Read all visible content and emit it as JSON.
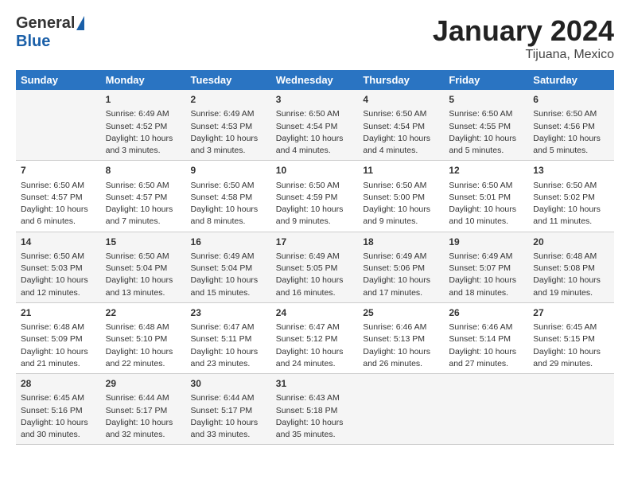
{
  "logo": {
    "general": "General",
    "blue": "Blue",
    "tagline": ""
  },
  "title": "January 2024",
  "subtitle": "Tijuana, Mexico",
  "headers": [
    "Sunday",
    "Monday",
    "Tuesday",
    "Wednesday",
    "Thursday",
    "Friday",
    "Saturday"
  ],
  "weeks": [
    [
      {
        "day": "",
        "sunrise": "",
        "sunset": "",
        "daylight": ""
      },
      {
        "day": "1",
        "sunrise": "Sunrise: 6:49 AM",
        "sunset": "Sunset: 4:52 PM",
        "daylight": "Daylight: 10 hours and 3 minutes."
      },
      {
        "day": "2",
        "sunrise": "Sunrise: 6:49 AM",
        "sunset": "Sunset: 4:53 PM",
        "daylight": "Daylight: 10 hours and 3 minutes."
      },
      {
        "day": "3",
        "sunrise": "Sunrise: 6:50 AM",
        "sunset": "Sunset: 4:54 PM",
        "daylight": "Daylight: 10 hours and 4 minutes."
      },
      {
        "day": "4",
        "sunrise": "Sunrise: 6:50 AM",
        "sunset": "Sunset: 4:54 PM",
        "daylight": "Daylight: 10 hours and 4 minutes."
      },
      {
        "day": "5",
        "sunrise": "Sunrise: 6:50 AM",
        "sunset": "Sunset: 4:55 PM",
        "daylight": "Daylight: 10 hours and 5 minutes."
      },
      {
        "day": "6",
        "sunrise": "Sunrise: 6:50 AM",
        "sunset": "Sunset: 4:56 PM",
        "daylight": "Daylight: 10 hours and 5 minutes."
      }
    ],
    [
      {
        "day": "7",
        "sunrise": "Sunrise: 6:50 AM",
        "sunset": "Sunset: 4:57 PM",
        "daylight": "Daylight: 10 hours and 6 minutes."
      },
      {
        "day": "8",
        "sunrise": "Sunrise: 6:50 AM",
        "sunset": "Sunset: 4:57 PM",
        "daylight": "Daylight: 10 hours and 7 minutes."
      },
      {
        "day": "9",
        "sunrise": "Sunrise: 6:50 AM",
        "sunset": "Sunset: 4:58 PM",
        "daylight": "Daylight: 10 hours and 8 minutes."
      },
      {
        "day": "10",
        "sunrise": "Sunrise: 6:50 AM",
        "sunset": "Sunset: 4:59 PM",
        "daylight": "Daylight: 10 hours and 9 minutes."
      },
      {
        "day": "11",
        "sunrise": "Sunrise: 6:50 AM",
        "sunset": "Sunset: 5:00 PM",
        "daylight": "Daylight: 10 hours and 9 minutes."
      },
      {
        "day": "12",
        "sunrise": "Sunrise: 6:50 AM",
        "sunset": "Sunset: 5:01 PM",
        "daylight": "Daylight: 10 hours and 10 minutes."
      },
      {
        "day": "13",
        "sunrise": "Sunrise: 6:50 AM",
        "sunset": "Sunset: 5:02 PM",
        "daylight": "Daylight: 10 hours and 11 minutes."
      }
    ],
    [
      {
        "day": "14",
        "sunrise": "Sunrise: 6:50 AM",
        "sunset": "Sunset: 5:03 PM",
        "daylight": "Daylight: 10 hours and 12 minutes."
      },
      {
        "day": "15",
        "sunrise": "Sunrise: 6:50 AM",
        "sunset": "Sunset: 5:04 PM",
        "daylight": "Daylight: 10 hours and 13 minutes."
      },
      {
        "day": "16",
        "sunrise": "Sunrise: 6:49 AM",
        "sunset": "Sunset: 5:04 PM",
        "daylight": "Daylight: 10 hours and 15 minutes."
      },
      {
        "day": "17",
        "sunrise": "Sunrise: 6:49 AM",
        "sunset": "Sunset: 5:05 PM",
        "daylight": "Daylight: 10 hours and 16 minutes."
      },
      {
        "day": "18",
        "sunrise": "Sunrise: 6:49 AM",
        "sunset": "Sunset: 5:06 PM",
        "daylight": "Daylight: 10 hours and 17 minutes."
      },
      {
        "day": "19",
        "sunrise": "Sunrise: 6:49 AM",
        "sunset": "Sunset: 5:07 PM",
        "daylight": "Daylight: 10 hours and 18 minutes."
      },
      {
        "day": "20",
        "sunrise": "Sunrise: 6:48 AM",
        "sunset": "Sunset: 5:08 PM",
        "daylight": "Daylight: 10 hours and 19 minutes."
      }
    ],
    [
      {
        "day": "21",
        "sunrise": "Sunrise: 6:48 AM",
        "sunset": "Sunset: 5:09 PM",
        "daylight": "Daylight: 10 hours and 21 minutes."
      },
      {
        "day": "22",
        "sunrise": "Sunrise: 6:48 AM",
        "sunset": "Sunset: 5:10 PM",
        "daylight": "Daylight: 10 hours and 22 minutes."
      },
      {
        "day": "23",
        "sunrise": "Sunrise: 6:47 AM",
        "sunset": "Sunset: 5:11 PM",
        "daylight": "Daylight: 10 hours and 23 minutes."
      },
      {
        "day": "24",
        "sunrise": "Sunrise: 6:47 AM",
        "sunset": "Sunset: 5:12 PM",
        "daylight": "Daylight: 10 hours and 24 minutes."
      },
      {
        "day": "25",
        "sunrise": "Sunrise: 6:46 AM",
        "sunset": "Sunset: 5:13 PM",
        "daylight": "Daylight: 10 hours and 26 minutes."
      },
      {
        "day": "26",
        "sunrise": "Sunrise: 6:46 AM",
        "sunset": "Sunset: 5:14 PM",
        "daylight": "Daylight: 10 hours and 27 minutes."
      },
      {
        "day": "27",
        "sunrise": "Sunrise: 6:45 AM",
        "sunset": "Sunset: 5:15 PM",
        "daylight": "Daylight: 10 hours and 29 minutes."
      }
    ],
    [
      {
        "day": "28",
        "sunrise": "Sunrise: 6:45 AM",
        "sunset": "Sunset: 5:16 PM",
        "daylight": "Daylight: 10 hours and 30 minutes."
      },
      {
        "day": "29",
        "sunrise": "Sunrise: 6:44 AM",
        "sunset": "Sunset: 5:17 PM",
        "daylight": "Daylight: 10 hours and 32 minutes."
      },
      {
        "day": "30",
        "sunrise": "Sunrise: 6:44 AM",
        "sunset": "Sunset: 5:17 PM",
        "daylight": "Daylight: 10 hours and 33 minutes."
      },
      {
        "day": "31",
        "sunrise": "Sunrise: 6:43 AM",
        "sunset": "Sunset: 5:18 PM",
        "daylight": "Daylight: 10 hours and 35 minutes."
      },
      {
        "day": "",
        "sunrise": "",
        "sunset": "",
        "daylight": ""
      },
      {
        "day": "",
        "sunrise": "",
        "sunset": "",
        "daylight": ""
      },
      {
        "day": "",
        "sunrise": "",
        "sunset": "",
        "daylight": ""
      }
    ]
  ]
}
